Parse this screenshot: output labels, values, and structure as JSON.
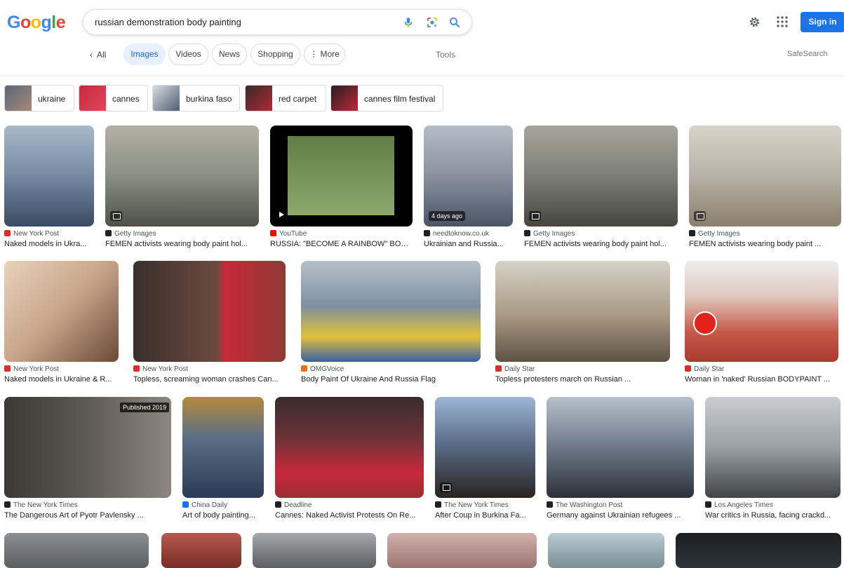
{
  "logo": [
    "G",
    "o",
    "o",
    "g",
    "l",
    "e"
  ],
  "search": {
    "query": "russian demonstration body painting"
  },
  "header": {
    "signin": "Sign in"
  },
  "tabs": {
    "all": "All",
    "items": [
      "Images",
      "Videos",
      "News",
      "Shopping",
      "More"
    ],
    "tools": "Tools",
    "safesearch": "SafeSearch"
  },
  "chips": [
    "ukraine",
    "cannes",
    "burkina faso",
    "red carpet",
    "cannes film festival"
  ],
  "results": [
    {
      "source": "New York Post",
      "title": "Naked models in Ukra...",
      "fav": "#d93025",
      "color": "#7b8fa8"
    },
    {
      "source": "Getty Images",
      "title": "FEMEN activists wearing body paint hol...",
      "fav": "#202124",
      "color": "#8a8f84"
    },
    {
      "source": "YouTube",
      "title": "RUSSIA: \"BECOME A RAINBOW\" BOD...",
      "fav": "#ff0000",
      "color": "#6f8a4f"
    },
    {
      "source": "needtoknow.co.uk",
      "title": "Ukrainian and Russia...",
      "fav": "#202124",
      "color": "#8e96a3",
      "badge": "4 days ago"
    },
    {
      "source": "Getty Images",
      "title": "FEMEN activists wearing body paint hol...",
      "fav": "#202124",
      "color": "#7d7f76"
    },
    {
      "source": "Getty Images",
      "title": "FEMEN activists wearing body paint ...",
      "fav": "#202124",
      "color": "#b7b2a6"
    },
    {
      "source": "New York Post",
      "title": "Naked models in Ukraine & R...",
      "fav": "#d93025",
      "color": "#c7a488"
    },
    {
      "source": "New York Post",
      "title": "Topless, screaming woman crashes Can...",
      "fav": "#d93025",
      "color": "#8d3b34"
    },
    {
      "source": "OMGVoice",
      "title": "Body Paint Of Ukraine And Russia Flag",
      "fav": "#e8710a",
      "color": "#7d8f9e"
    },
    {
      "source": "Daily Star",
      "title": "Topless protesters march on Russian ...",
      "fav": "#d93025",
      "color": "#a79882"
    },
    {
      "source": "Daily Star",
      "title": "Woman in 'naked' Russian BODYPAINT ...",
      "fav": "#d93025",
      "color": "#c65a4a"
    },
    {
      "source": "The New York Times",
      "title": "The Dangerous Art of Pyotr Pavlensky ...",
      "fav": "#202124",
      "color": "#5e5a55",
      "badge": "Published 2019"
    },
    {
      "source": "China Daily",
      "title": "Art of body painting...",
      "fav": "#1a73e8",
      "color": "#5b6f86"
    },
    {
      "source": "Deadline",
      "title": "Cannes: Naked Activist Protests On Re...",
      "fav": "#202124",
      "color": "#9b2f35"
    },
    {
      "source": "The New York Times",
      "title": "After Coup in Burkina Fa...",
      "fav": "#202124",
      "color": "#5c6f8a"
    },
    {
      "source": "The Washington Post",
      "title": "Germany against Ukrainian refugees ...",
      "fav": "#202124",
      "color": "#73808f"
    },
    {
      "source": "Los Angeles Times",
      "title": "War critics in Russia, facing crackd...",
      "fav": "#202124",
      "color": "#9aa0a4"
    }
  ],
  "row4": [
    "#6c7072",
    "#9d4238",
    "#7a7b80",
    "#b48d8b",
    "#8ea3a8",
    "#1f2426"
  ]
}
